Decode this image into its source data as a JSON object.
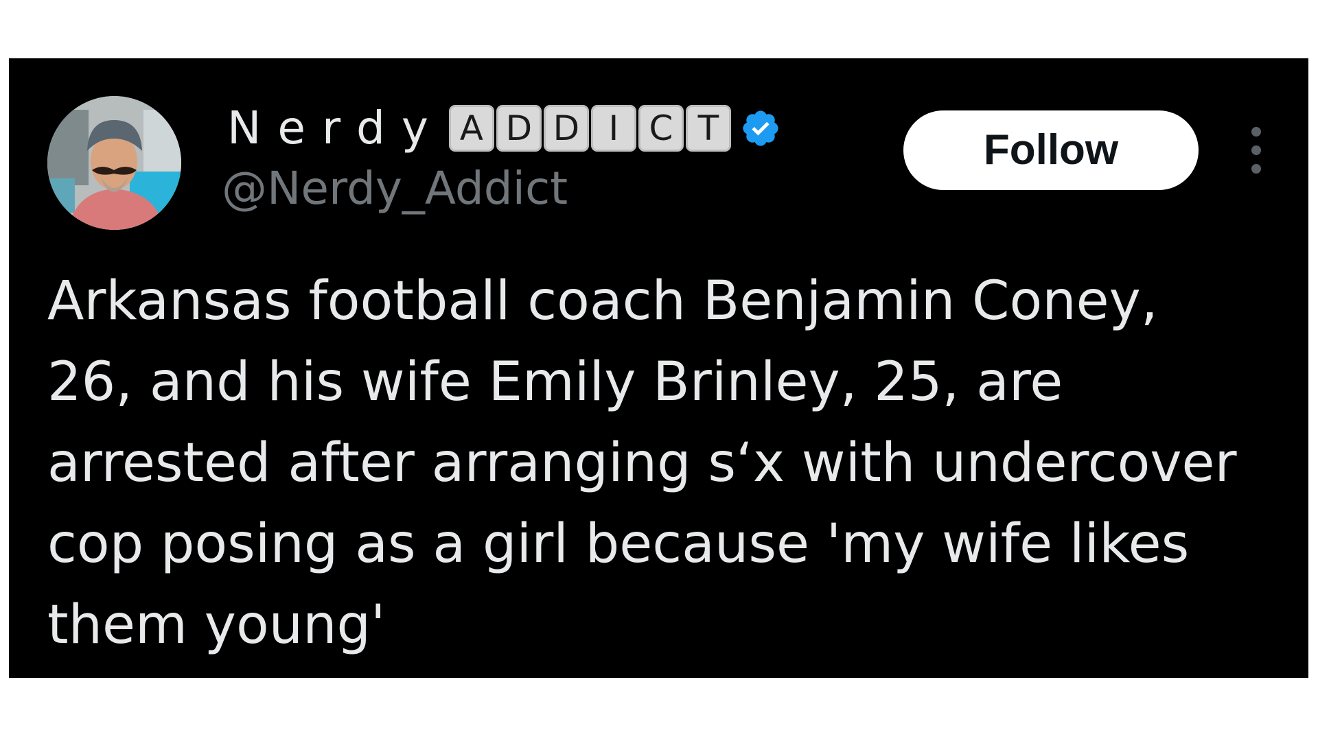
{
  "author": {
    "name_prefix": "Nerdy",
    "name_badge_letters": [
      "A",
      "D",
      "D",
      "I",
      "C",
      "T"
    ],
    "handle": "@Nerdy_Addict",
    "verified": true
  },
  "follow_button": {
    "label": "Follow"
  },
  "more_menu": {
    "icon": "more-vertical-icon"
  },
  "tweet": {
    "lines": [
      "Arkansas football coach Benjamin Coney,",
      "26, and his wife Emily Brinley, 25, are",
      "arrested after arranging sʻx with undercover",
      "cop posing as a girl because 'my wife likes",
      "them young'"
    ]
  },
  "colors": {
    "card_background": "#000000",
    "verified_badge": "#1d9bf0",
    "text_primary": "#e7e9ea",
    "text_secondary": "#71767b",
    "follow_button_bg": "#ffffff"
  }
}
